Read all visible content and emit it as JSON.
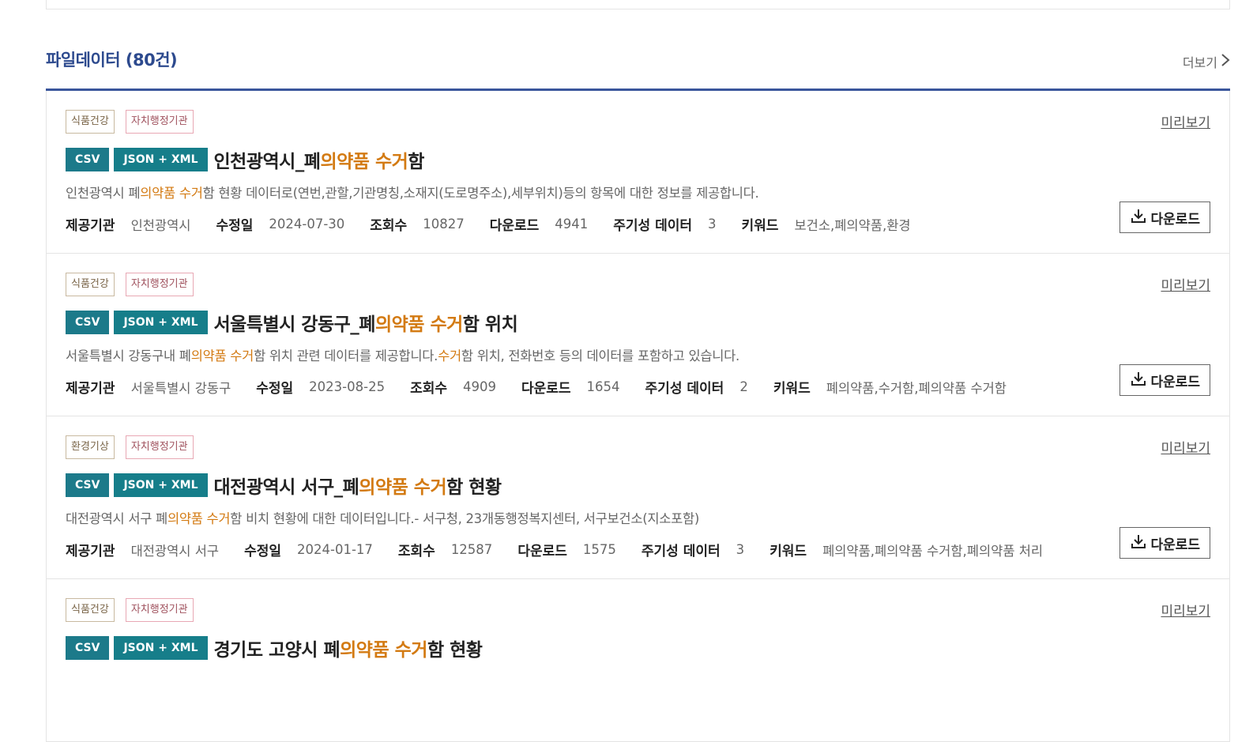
{
  "section": {
    "title": "파일데이터 (80건)",
    "more_label": "더보기"
  },
  "labels": {
    "provider": "제공기관",
    "modified": "수정일",
    "views": "조회수",
    "downloads": "다운로드",
    "periodic": "주기성 데이터",
    "keywords": "키워드",
    "preview": "미리보기",
    "download_btn": "다운로드"
  },
  "items": [
    {
      "tags": [
        "식품건강",
        "자치행정기관"
      ],
      "formats": [
        "CSV",
        "JSON + XML"
      ],
      "title": {
        "pre": "인천광역시_폐",
        "hl": "의약품 수거",
        "post": "함"
      },
      "desc": {
        "pre": "인천광역시 폐",
        "hl": "의약품 수거",
        "post": "함 현황 데이터로(연번,관할,기관명칭,소재지(도로명주소),세부위치)등의 항목에 대한 정보를 제공합니다."
      },
      "provider": "인천광역시",
      "modified": "2024-07-30",
      "views": "10827",
      "downloads": "4941",
      "periodic": "3",
      "keywords": "보건소,폐의약품,환경"
    },
    {
      "tags": [
        "식품건강",
        "자치행정기관"
      ],
      "formats": [
        "CSV",
        "JSON + XML"
      ],
      "title": {
        "pre": "서울특별시 강동구_폐",
        "hl": "의약품 수거",
        "post": "함 위치"
      },
      "desc": {
        "pre": "서울특별시 강동구내 폐",
        "hl": "의약품 수거",
        "mid": "함 위치 관련 데이터를 제공합니다.",
        "hl2": "수거",
        "post": "함 위치, 전화번호 등의 데이터를 포함하고 있습니다."
      },
      "provider": "서울특별시 강동구",
      "modified": "2023-08-25",
      "views": "4909",
      "downloads": "1654",
      "periodic": "2",
      "keywords": "폐의약품,수거함,폐의약품 수거함"
    },
    {
      "tags": [
        "환경기상",
        "자치행정기관"
      ],
      "formats": [
        "CSV",
        "JSON + XML"
      ],
      "title": {
        "pre": "대전광역시 서구_폐",
        "hl": "의약품 수거",
        "post": "함 현황"
      },
      "desc": {
        "pre": "대전광역시 서구 폐",
        "hl": "의약품 수거",
        "post": "함 비치 현황에 대한 데이터입니다.- 서구청, 23개동행정복지센터, 서구보건소(지소포함)"
      },
      "provider": "대전광역시 서구",
      "modified": "2024-01-17",
      "views": "12587",
      "downloads": "1575",
      "periodic": "3",
      "keywords": "폐의약품,폐의약품 수거함,폐의약품 처리"
    },
    {
      "tags": [
        "식품건강",
        "자치행정기관"
      ],
      "formats": [
        "CSV",
        "JSON + XML"
      ],
      "title": {
        "pre": "경기도 고양시 폐",
        "hl": "의약품 수거",
        "post": "함 현황"
      }
    }
  ]
}
